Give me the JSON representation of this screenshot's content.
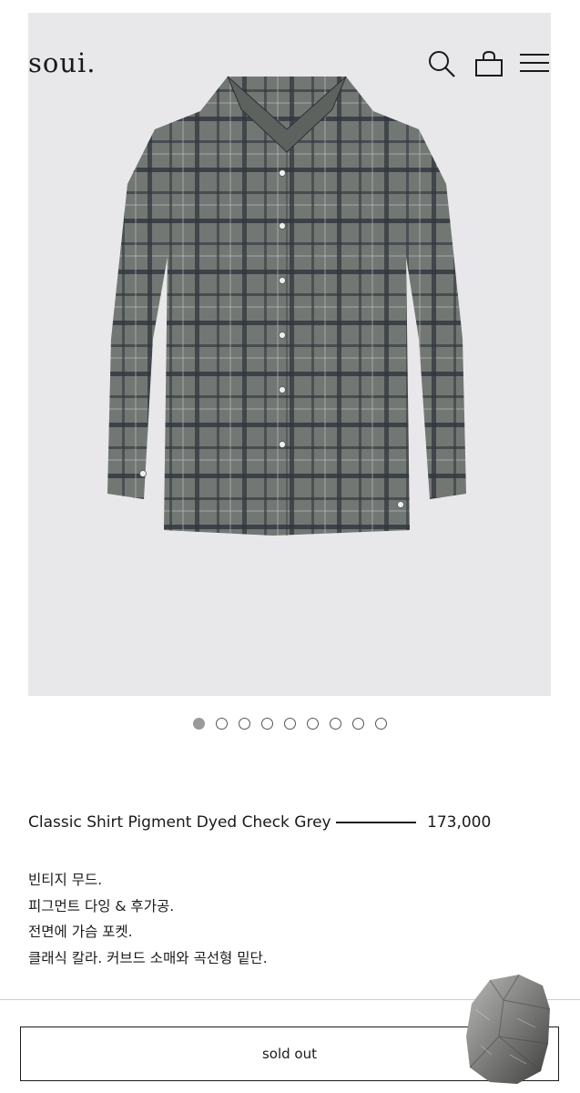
{
  "header": {
    "logo": "soui.",
    "icons": [
      "search-icon",
      "shopping-bag-icon",
      "hamburger-menu-icon"
    ]
  },
  "gallery": {
    "image": "grey-check-shirt",
    "total_slides": 9,
    "active_slide": 1
  },
  "product": {
    "name": "Classic Shirt Pigment Dyed Check Grey",
    "price": "173,000",
    "description": [
      "빈티지 무드.",
      "피그먼트 다잉 & 후가공.",
      "전면에 가슴 포켓.",
      "클래식 칼라. 커브드 소매와 곡선형 밑단."
    ]
  },
  "actions": {
    "sold_out_label": "sold out"
  },
  "colors": {
    "hero_bg": "#e8e8ea",
    "text": "#1a1a1a",
    "shirt_base": "#6f7370",
    "check_lines": "#2a2f3a"
  }
}
